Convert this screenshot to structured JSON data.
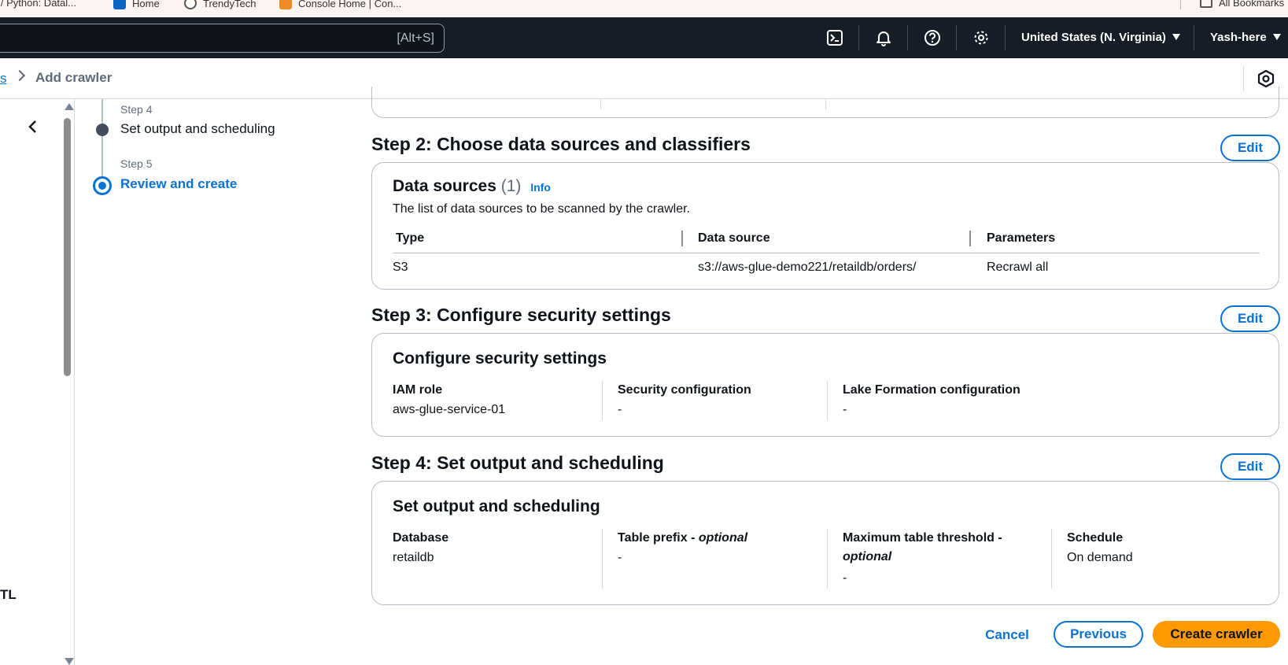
{
  "bookmarks": [
    {
      "label": "l/ Python: Datal..."
    },
    {
      "label": "Home"
    },
    {
      "label": "TrendyTech"
    },
    {
      "label": "Console Home | Con..."
    },
    {
      "label": "All Bookmarks"
    }
  ],
  "topnav": {
    "search_shortcut": "[Alt+S]",
    "region": "United States (N. Virginia)",
    "user": "Yash-here"
  },
  "breadcrumb": {
    "parent": "s",
    "current": "Add crawler"
  },
  "left_fragment": "TL",
  "steps": [
    {
      "label": "Step 4",
      "title": "Set output and scheduling"
    },
    {
      "label": "Step 5",
      "title": "Review and create"
    }
  ],
  "step2": {
    "heading": "Step 2: Choose data sources and classifiers",
    "edit": "Edit",
    "card_title": "Data sources",
    "count": "(1)",
    "info": "Info",
    "description": "The list of data sources to be scanned by the crawler.",
    "columns": [
      "Type",
      "Data source",
      "Parameters"
    ],
    "rows": [
      [
        "S3",
        "s3://aws-glue-demo221/retaildb/orders/",
        "Recrawl all"
      ]
    ]
  },
  "step3": {
    "heading": "Step 3: Configure security settings",
    "edit": "Edit",
    "card_title": "Configure security settings",
    "fields": [
      {
        "key": "IAM role",
        "value": "aws-glue-service-01"
      },
      {
        "key": "Security configuration",
        "value": "-"
      },
      {
        "key": "Lake Formation configuration",
        "value": "-"
      }
    ]
  },
  "step4": {
    "heading": "Step 4: Set output and scheduling",
    "edit": "Edit",
    "card_title": "Set output and scheduling",
    "fields": [
      {
        "key": "Database",
        "optional": "",
        "value": "retaildb"
      },
      {
        "key": "Table prefix - ",
        "optional": "optional",
        "value": "-"
      },
      {
        "key": "Maximum table threshold - ",
        "optional": "optional",
        "value": "-"
      },
      {
        "key": "Schedule",
        "optional": "",
        "value": "On demand"
      }
    ]
  },
  "actions": {
    "cancel": "Cancel",
    "previous": "Previous",
    "create": "Create crawler"
  },
  "colors": {
    "nav_bg": "#161d26",
    "link_blue": "#0972d3",
    "primary_orange": "#ff9900",
    "border_grey": "#b6bec9"
  }
}
